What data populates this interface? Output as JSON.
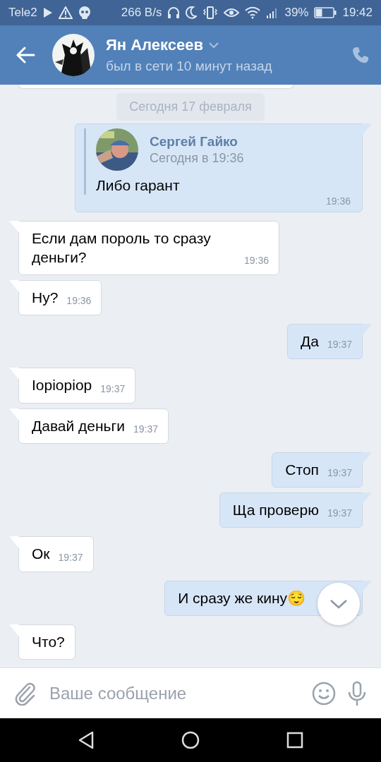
{
  "status_bar": {
    "carrier": "Tele2",
    "speed": "266 B/s",
    "battery": "39%",
    "time": "19:42"
  },
  "header": {
    "name": "Ян Алексеев",
    "status": "был в сети 10 минут назад"
  },
  "date_label": "Сегодня 17 февраля",
  "messages": [
    {
      "kind": "forward",
      "outgoing": true,
      "author": "Сергей Гайко",
      "author_time": "Сегодня в 19:36",
      "text": "Либо гарант",
      "time": "19:36"
    },
    {
      "kind": "text",
      "outgoing": false,
      "text": "Если дам пороль то сразу деньги?",
      "time": "19:36"
    },
    {
      "kind": "text",
      "outgoing": false,
      "text": "Ну?",
      "time": "19:36"
    },
    {
      "kind": "text",
      "outgoing": true,
      "text": "Да",
      "time": "19:37"
    },
    {
      "kind": "text",
      "outgoing": false,
      "text": "Iopiopiop",
      "time": "19:37"
    },
    {
      "kind": "text",
      "outgoing": false,
      "text": "Давай деньги",
      "time": "19:37"
    },
    {
      "kind": "text",
      "outgoing": true,
      "text": "Стоп",
      "time": "19:37"
    },
    {
      "kind": "text",
      "outgoing": true,
      "text": "Ща проверю",
      "time": "19:37"
    },
    {
      "kind": "text",
      "outgoing": false,
      "text": "Ок",
      "time": "19:37"
    },
    {
      "kind": "text",
      "outgoing": true,
      "text": "И сразу же кину😌"
    },
    {
      "kind": "text",
      "outgoing": false,
      "text": "Что?"
    }
  ],
  "composer": {
    "placeholder": "Ваше сообщение"
  }
}
